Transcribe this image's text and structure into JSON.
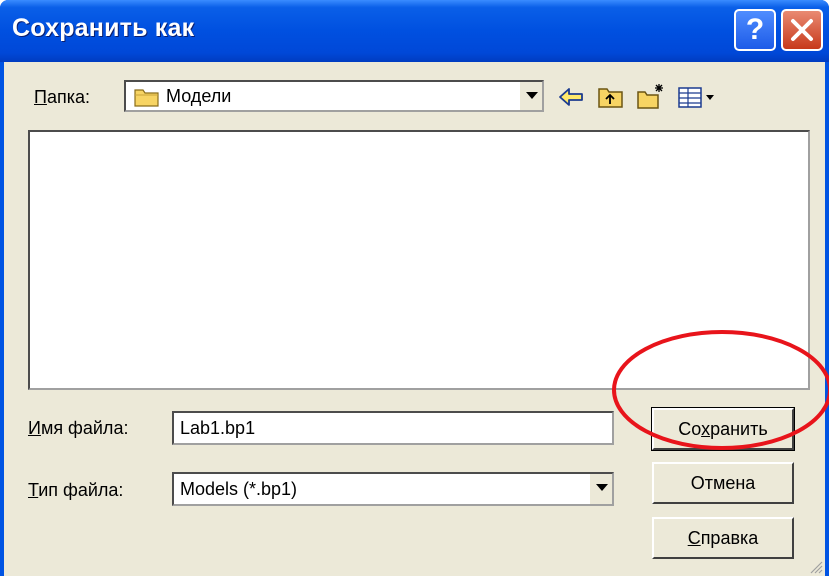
{
  "window": {
    "title": "Сохранить как",
    "help_label": "?"
  },
  "folder": {
    "label": "Папка:",
    "label_mnemonic": "П",
    "label_rest": "апка:",
    "value": "Модели"
  },
  "toolbar": {
    "icons": [
      "back-arrow-icon",
      "up-folder-icon",
      "new-folder-icon",
      "view-menu-icon"
    ]
  },
  "filename": {
    "label_mnemonic": "И",
    "label_rest": "мя файла:",
    "value": "Lab1.bp1"
  },
  "filetype": {
    "label_mnemonic": "Т",
    "label_rest": "ип файла:",
    "value": "Models (*.bp1)"
  },
  "buttons": {
    "save_pre": "Со",
    "save_mnemonic": "х",
    "save_post": "ранить",
    "cancel": "Отмена",
    "help_mnemonic": "С",
    "help_rest": "правка"
  },
  "annotation": {
    "color": "#e8141b"
  }
}
